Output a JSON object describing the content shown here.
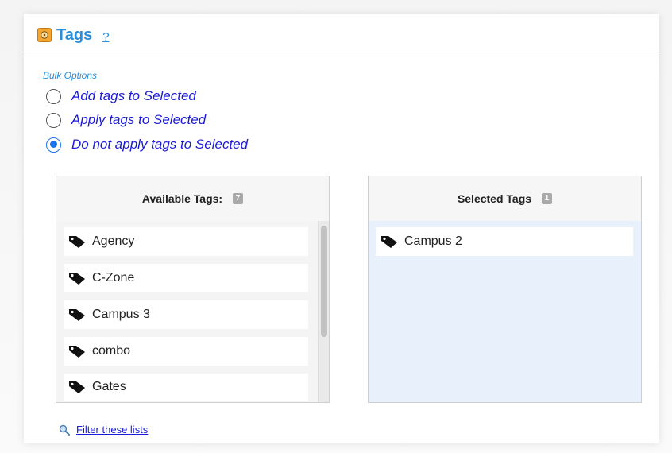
{
  "header": {
    "title": "Tags",
    "help": "?"
  },
  "bulk": {
    "label": "Bulk Options",
    "options": [
      {
        "label": "Add tags to Selected",
        "checked": false
      },
      {
        "label": "Apply tags to Selected",
        "checked": false
      },
      {
        "label": "Do not apply tags to Selected",
        "checked": true
      }
    ]
  },
  "available": {
    "title": "Available Tags:",
    "count": "7",
    "items": [
      "Agency",
      "C-Zone",
      "Campus 3",
      "combo",
      "Gates"
    ]
  },
  "selected": {
    "title": "Selected Tags",
    "count": "1",
    "items": [
      "Campus 2"
    ]
  },
  "filter": {
    "label": "Filter these lists"
  },
  "colors": {
    "accent": "#2a8fd8",
    "option_text": "#1a1ad8",
    "radio_checked": "#1a73e8",
    "selected_bg": "#e8f1fb"
  }
}
